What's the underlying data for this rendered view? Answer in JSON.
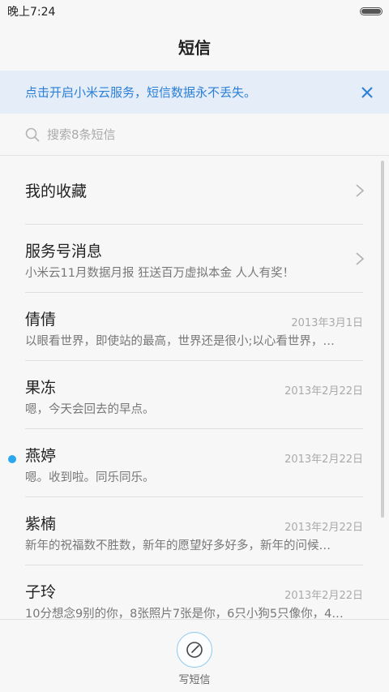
{
  "status": {
    "time": "晚上7:24"
  },
  "header": {
    "title": "短信"
  },
  "banner": {
    "text": "点击开启小米云服务，短信数据永不丢失。"
  },
  "search": {
    "placeholder": "搜索8条短信"
  },
  "list": {
    "items": [
      {
        "name": "我的收藏",
        "preview": "",
        "date": "",
        "chevron": true
      },
      {
        "name": "服务号消息",
        "preview": "小米云11月数据月报 狂送百万虚拟本金 人人有奖！",
        "date": "",
        "chevron": true
      },
      {
        "name": "倩倩",
        "preview": "以眼看世界，即使站的最高，世界还是很小;以心看世界，…",
        "date": "2013年3月1日"
      },
      {
        "name": "果冻",
        "preview": "嗯，今天会回去的早点。",
        "date": "2013年2月22日"
      },
      {
        "name": "燕婷",
        "preview": "嗯。收到啦。同乐同乐。",
        "date": "2013年2月22日",
        "unread": true
      },
      {
        "name": "紫楠",
        "preview": "新年的祝福数不胜数，新年的愿望好多好多，新年的问候…",
        "date": "2013年2月22日"
      },
      {
        "name": "子玲",
        "preview": "10分想念9别的你，8张照片7张是你，6只小狗5只像你，4…",
        "date": "2013年2月22日"
      }
    ]
  },
  "bottom": {
    "compose_label": "写短信"
  },
  "colors": {
    "accent": "#2b7fd6",
    "banner_bg": "#e4edf8",
    "unread": "#2aa7ee"
  },
  "icons": {
    "search": "search-icon",
    "close": "close-icon",
    "chevron": "chevron-right-icon",
    "compose": "compose-icon"
  }
}
